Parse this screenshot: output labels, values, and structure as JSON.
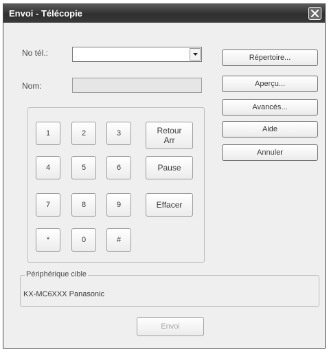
{
  "window": {
    "title": "Envoi - Télécopie"
  },
  "form": {
    "number_label": "No tél.:",
    "number_value": "",
    "name_label": "Nom:",
    "name_value": ""
  },
  "side_buttons": {
    "directory": "Répertoire...",
    "preview": "Aperçu...",
    "advanced": "Avancés...",
    "help": "Aide",
    "cancel": "Annuler"
  },
  "keypad": {
    "keys": [
      "1",
      "2",
      "3",
      "4",
      "5",
      "6",
      "7",
      "8",
      "9",
      "*",
      "0",
      "#"
    ],
    "backspace": "Retour\nArr",
    "pause": "Pause",
    "clear": "Effacer"
  },
  "device": {
    "legend": "Périphérique cible",
    "value": "KX-MC6XXX Panasonic"
  },
  "footer": {
    "send": "Envoi"
  },
  "icons": {
    "close": "close-icon",
    "dropdown": "chevron-down-icon"
  }
}
